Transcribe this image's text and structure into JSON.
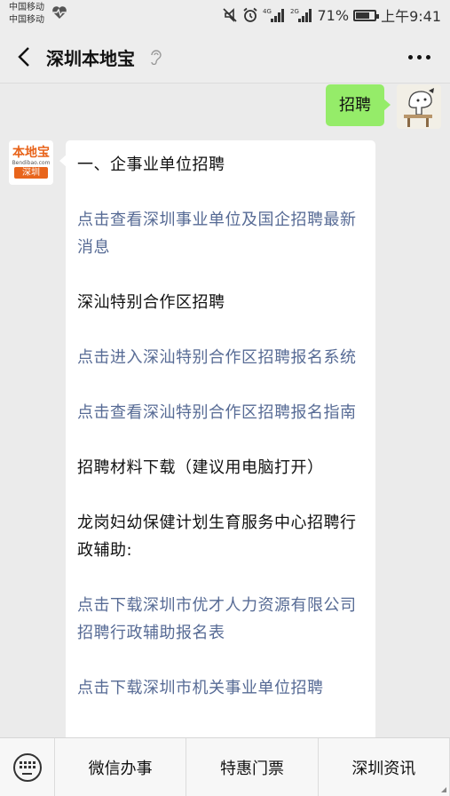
{
  "status_bar": {
    "carrier_1": "中国移动",
    "carrier_2": "中国移动",
    "net_1": "4G",
    "net_2": "2G",
    "battery": "71%",
    "time": "上午9:41"
  },
  "header": {
    "title": "深圳本地宝"
  },
  "chat": {
    "user_message": "招聘",
    "bot_avatar_logo": "本地宝",
    "bot_avatar_site": "Bendibao.com",
    "bot_avatar_city": "深圳",
    "paragraphs": [
      {
        "text": "一、企事业单位招聘",
        "link": false
      },
      {
        "text": "点击查看深圳事业单位及国企招聘最新消息",
        "link": true
      },
      {
        "text": "深汕特别合作区招聘",
        "link": false
      },
      {
        "text": "点击进入深汕特别合作区招聘报名系统",
        "link": true
      },
      {
        "text": "点击查看深汕特别合作区招聘报名指南",
        "link": true
      },
      {
        "text": "招聘材料下载（建议用电脑打开）",
        "link": false
      },
      {
        "text": "龙岗妇幼保健计划生育服务中心招聘行政辅助:",
        "link": false
      },
      {
        "text": "点击下载深圳市优才人力资源有限公司招聘行政辅助报名表",
        "link": true
      },
      {
        "text": "点击下载深圳市机关事业单位招聘",
        "link": true
      }
    ]
  },
  "bottom_menu": {
    "items": [
      "微信办事",
      "特惠门票",
      "深圳资讯"
    ]
  },
  "colors": {
    "user_bubble": "#95ec69",
    "link": "#576b95",
    "logo_orange": "#e8641b"
  }
}
